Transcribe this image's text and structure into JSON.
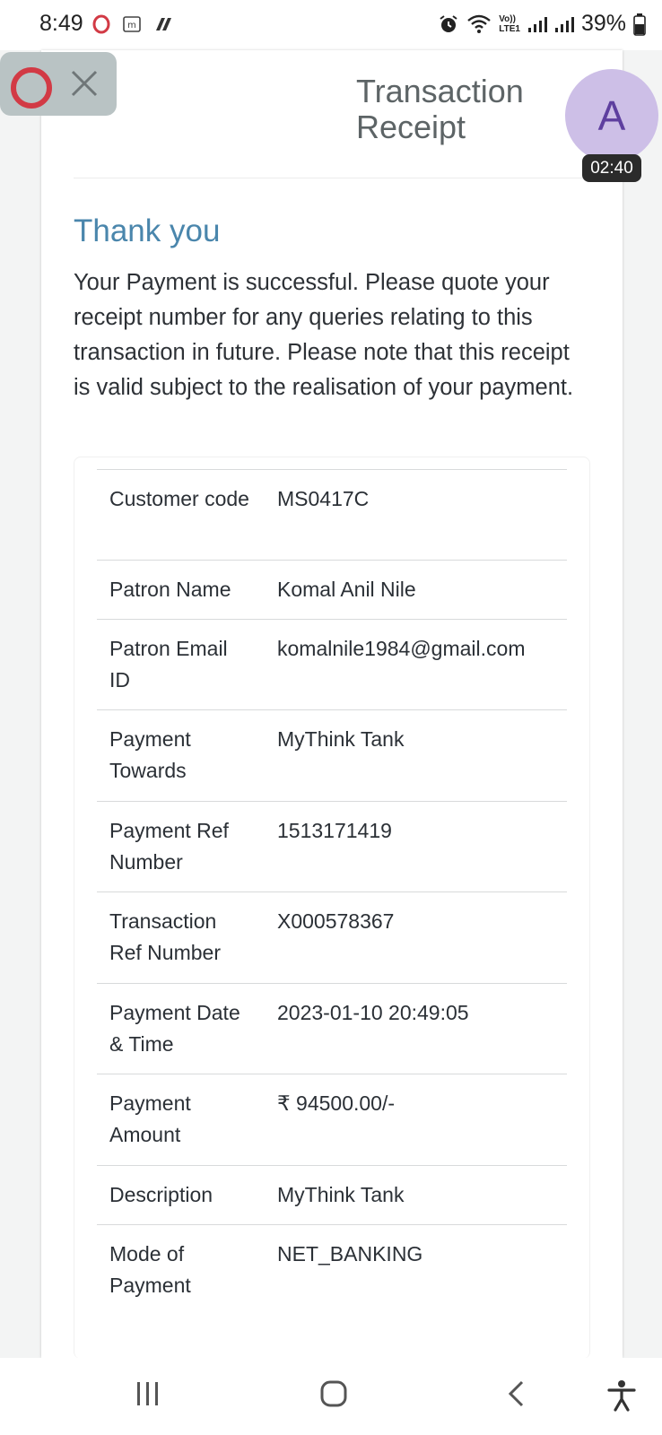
{
  "status_bar": {
    "time": "8:49",
    "left_icons": [
      "opera-icon",
      "m-notification-icon",
      "app-notification-icon"
    ],
    "network_label_top": "Vo))",
    "network_label_bottom": "LTE1",
    "battery": "39%"
  },
  "header": {
    "title": "Transaction Receipt"
  },
  "overlay": {
    "recorder_icons": [
      "record-icon",
      "close-icon"
    ],
    "avatar_letter": "A",
    "timer": "02:40"
  },
  "content": {
    "heading": "Thank you",
    "message": "Your Payment is successful. Please quote your receipt number for any queries relating to this transaction in future. Please note that this receipt is valid subject to the realisation of your payment."
  },
  "receipt_rows": [
    {
      "label": "Customer code",
      "value": "MS0417C"
    },
    {
      "label": "Patron Name",
      "value": "Komal Anil Nile"
    },
    {
      "label": "Patron Email ID",
      "value": "komalnile1984@gmail.com"
    },
    {
      "label": "Payment Towards",
      "value": "MyThink Tank"
    },
    {
      "label": "Payment Ref Number",
      "value": "1513171419"
    },
    {
      "label": "Transaction Ref Number",
      "value": "X000578367"
    },
    {
      "label": "Payment Date & Time",
      "value": "2023-01-10 20:49:05"
    },
    {
      "label": "Payment Amount",
      "value": "₹ 94500.00/-"
    },
    {
      "label": "Description",
      "value": "MyThink Tank"
    },
    {
      "label": "Mode of Payment",
      "value": "NET_BANKING"
    }
  ],
  "nav_bar": {
    "buttons": [
      "recent-apps-icon",
      "home-icon",
      "back-icon",
      "accessibility-icon"
    ]
  }
}
